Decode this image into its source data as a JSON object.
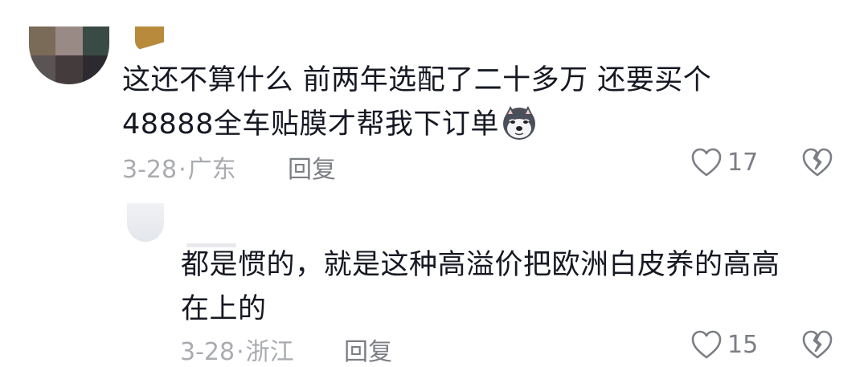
{
  "comments": [
    {
      "text_line1": "这还不算什么  前两年选配了二十多万 还要买个",
      "text_line2": "48888全车贴膜才帮我下订单",
      "emoji": "husky-dog-emoji",
      "date": "3-28",
      "dot": "·",
      "location": "广东",
      "reply_label": "回复",
      "likes": "17"
    },
    {
      "text_line1": "都是惯的，就是这种高溢价把欧洲白皮养的高高",
      "text_line2": "在上的",
      "date": "3-28",
      "dot": "·",
      "location": "浙江",
      "reply_label": "回复",
      "likes": "15"
    }
  ],
  "colors": {
    "text": "#161823",
    "meta": "#a9abb0",
    "action": "#7c7e85",
    "avatar_pixels": [
      "#7a6a58",
      "#9a8a86",
      "#3a4a44",
      "#5a5454",
      "#443c3c",
      "#2c2a2e"
    ]
  }
}
